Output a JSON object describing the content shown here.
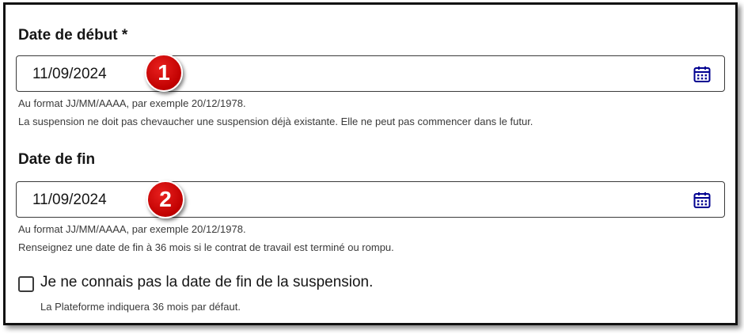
{
  "start_date": {
    "label": "Date de début *",
    "value": "11/09/2024",
    "hint_format": "Au format JJ/MM/AAAA, par exemple 20/12/1978.",
    "hint_rule": "La suspension ne doit pas chevaucher une suspension déjà existante. Elle ne peut pas commencer dans le futur.",
    "badge": "1"
  },
  "end_date": {
    "label": "Date de fin",
    "value": "11/09/2024",
    "hint_format": "Au format JJ/MM/AAAA, par exemple 20/12/1978.",
    "hint_rule": "Renseignez une date de fin à 36 mois si le contrat de travail est terminé ou rompu.",
    "badge": "2"
  },
  "unknown_end": {
    "label": "Je ne connais pas la date de fin de la suspension.",
    "hint": "La Plateforme indiquera 36 mois par défaut.",
    "checked": false
  },
  "colors": {
    "badge_red": "#c00000",
    "icon_blue": "#000091",
    "text": "#161616"
  }
}
